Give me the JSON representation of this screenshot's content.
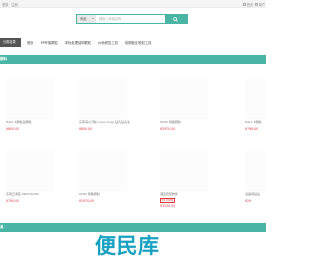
{
  "topbar": {
    "login": "登录",
    "register": "注册",
    "right_items": [
      {
        "icon": "square-icon",
        "label": "首页"
      },
      {
        "icon": "square-icon",
        "label": "用户"
      }
    ]
  },
  "search": {
    "category": "商品",
    "placeholder": "搜索入商品名称",
    "button_icon": "search-icon"
  },
  "nav": {
    "all_categories": "分类目录",
    "links": [
      "首页",
      "PP环保颗粒",
      "非标处理结构颗粒",
      "炒地修复工具",
      "前期营业规划工具"
    ]
  },
  "sections": [
    {
      "title": "颗料"
    },
    {
      "title": "具"
    }
  ],
  "products_row1": [
    {
      "name": "HALL 5颗粒钻颗粒",
      "price": "¥800.00"
    },
    {
      "name": "东南海/(订购) (one rung) 钻孔钻头生",
      "price": "¥800.00"
    },
    {
      "name": "OHIO 特殊颗粒",
      "price": "¥2970.00"
    },
    {
      "name": "HALL 5颗粒",
      "price": "¥798.00"
    }
  ],
  "products_row2": [
    {
      "name": "东南云海区 MDCC5200",
      "price": "¥790.00"
    },
    {
      "name": "OHIO 特殊颗粒",
      "price": "¥2970.00"
    },
    {
      "name": "酒店套装物件",
      "tag": "¥3.00/件",
      "price": "¥3530.00"
    },
    {
      "name": "设备用钻钻",
      "price": "¥29"
    }
  ],
  "watermark": "便民库",
  "colors": {
    "accent": "#4ab5a4",
    "price": "#e4393c",
    "nav_dark": "#545454",
    "watermark": "#17a2c2"
  }
}
